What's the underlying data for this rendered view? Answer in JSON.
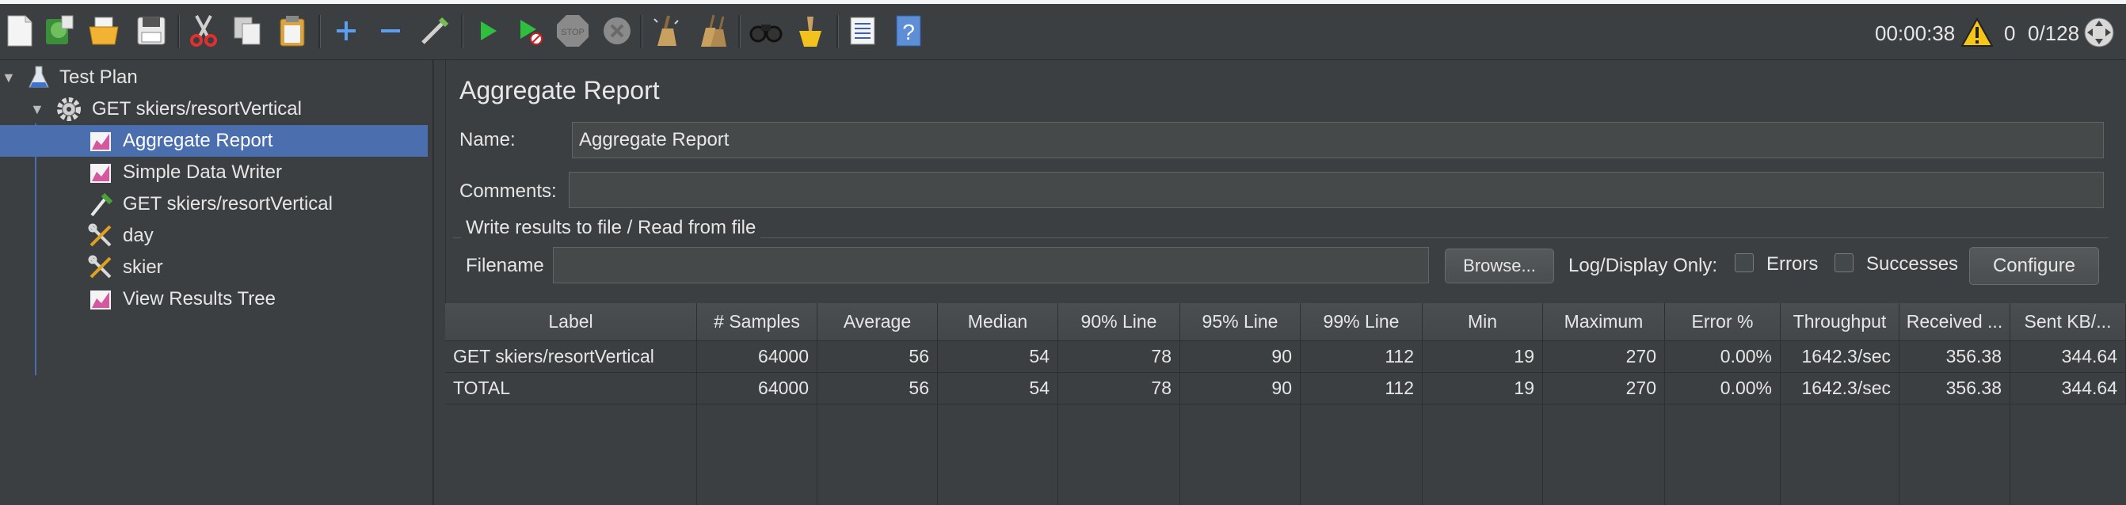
{
  "toolbar": {
    "icons": [
      "new-icon",
      "templates-icon",
      "open-icon",
      "save-icon",
      "cut-icon",
      "copy-icon",
      "paste-icon",
      "expand-all-icon",
      "collapse-all-icon",
      "toggle-icon",
      "start-icon",
      "start-no-pauses-icon",
      "stop-icon",
      "shutdown-icon",
      "clear-icon",
      "clear-all-icon",
      "search-icon",
      "reset-search-icon",
      "function-helper-icon",
      "help-icon"
    ],
    "elapsed": "00:00:38",
    "warning_count": "0",
    "threads": "0/128"
  },
  "tree": {
    "items": [
      {
        "label": "Test Plan",
        "icon": "flask-icon"
      },
      {
        "label": "GET skiers/resortVertical",
        "icon": "gear-icon"
      },
      {
        "label": "Aggregate Report",
        "icon": "chart-icon"
      },
      {
        "label": "Simple Data Writer",
        "icon": "chart-icon"
      },
      {
        "label": "GET skiers/resortVertical",
        "icon": "pipette-icon"
      },
      {
        "label": "day",
        "icon": "tools-icon"
      },
      {
        "label": "skier",
        "icon": "tools-icon"
      },
      {
        "label": "View Results Tree",
        "icon": "chart-icon"
      }
    ]
  },
  "panel": {
    "title": "Aggregate Report",
    "name_label": "Name:",
    "name_value": "Aggregate Report",
    "comments_label": "Comments:",
    "comments_value": "",
    "file_group_title": "Write results to file / Read from file",
    "filename_label": "Filename",
    "filename_value": "",
    "browse_label": "Browse...",
    "log_display_label": "Log/Display Only:",
    "errors_label": "Errors",
    "successes_label": "Successes",
    "configure_label": "Configure"
  },
  "table": {
    "headers": [
      "Label",
      "# Samples",
      "Average",
      "Median",
      "90% Line",
      "95% Line",
      "99% Line",
      "Min",
      "Maximum",
      "Error %",
      "Throughput",
      "Received ...",
      "Sent KB/..."
    ],
    "rows": [
      [
        "GET skiers/resortVertical",
        "64000",
        "56",
        "54",
        "78",
        "90",
        "112",
        "19",
        "270",
        "0.00%",
        "1642.3/sec",
        "356.38",
        "344.64"
      ],
      [
        "TOTAL",
        "64000",
        "56",
        "54",
        "78",
        "90",
        "112",
        "19",
        "270",
        "0.00%",
        "1642.3/sec",
        "356.38",
        "344.64"
      ]
    ]
  }
}
